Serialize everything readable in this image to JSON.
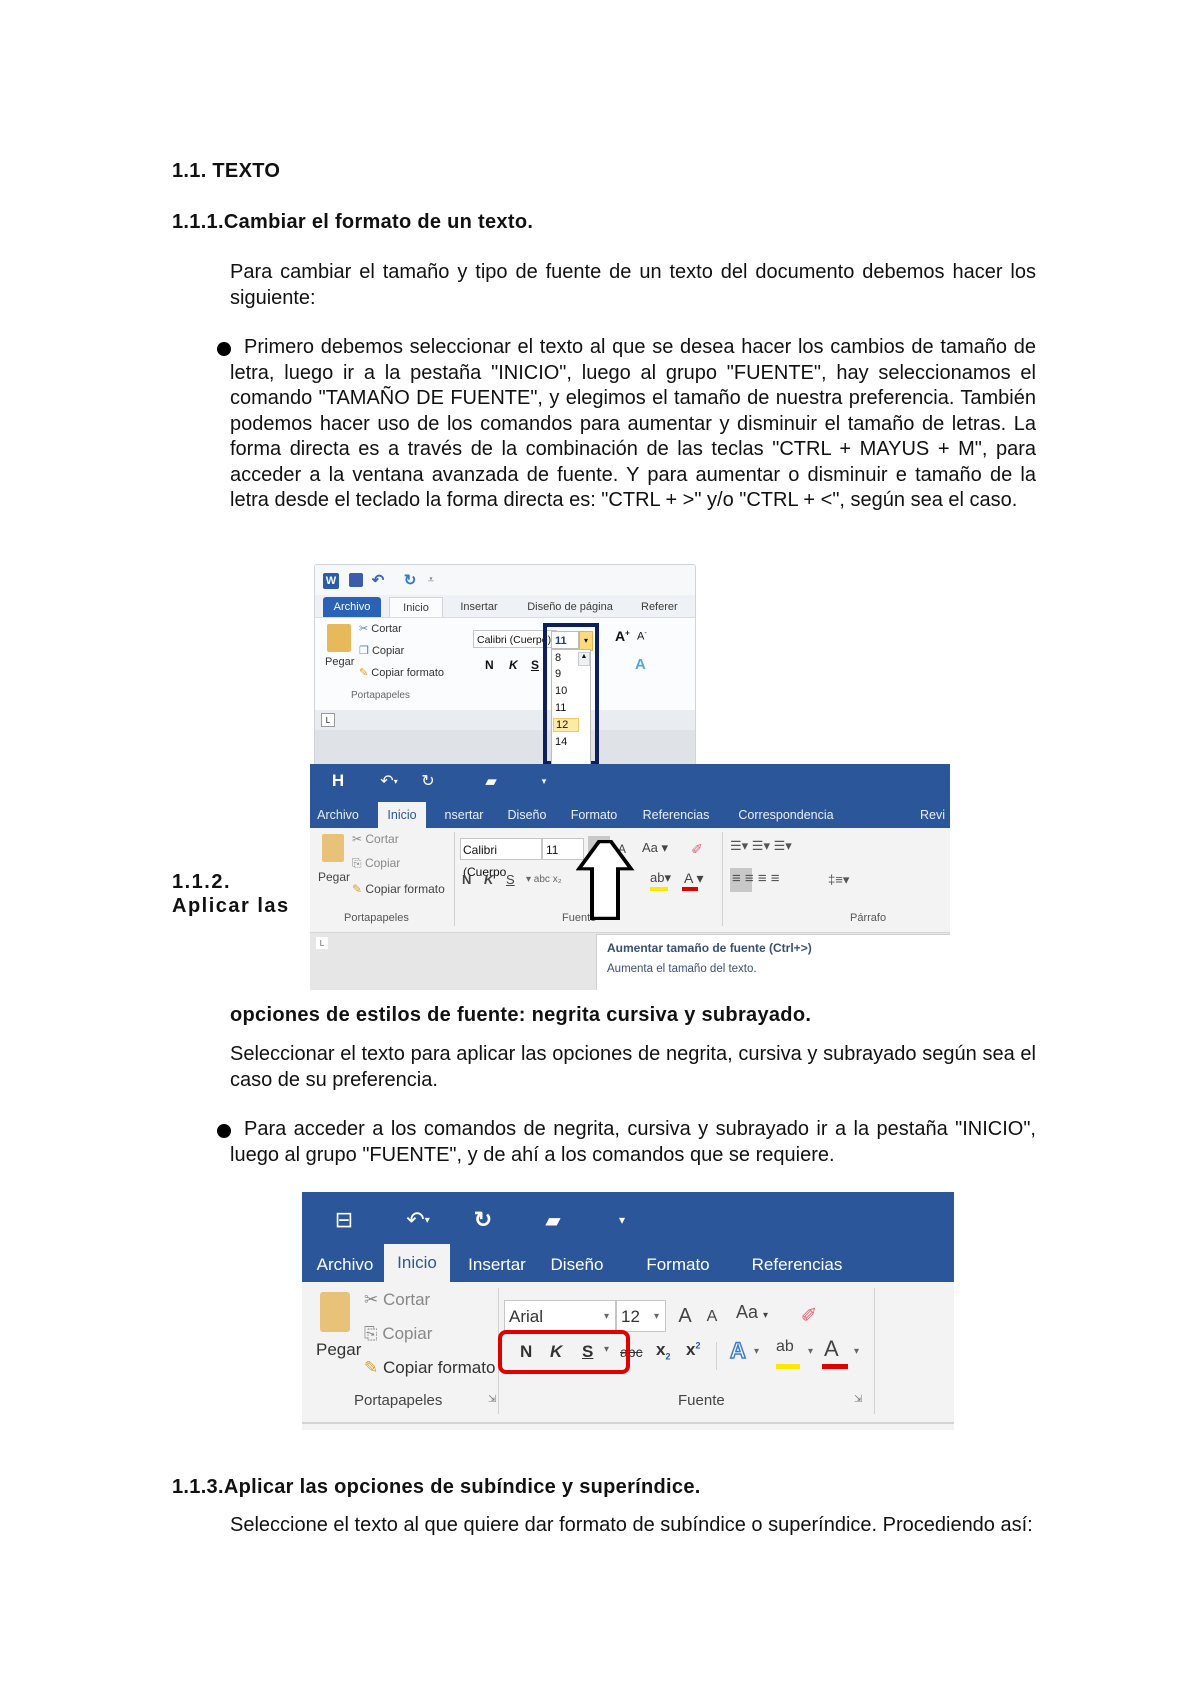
{
  "document": {
    "heading_1": "1.1. TEXTO",
    "section_1": {
      "number": "1.1.1.",
      "title": "Cambiar el formato de un texto.",
      "intro": "Para cambiar el tamaño y tipo de fuente de un texto del documento debemos hacer los siguiente:",
      "bullet": "Primero debemos seleccionar el texto al que se desea hacer los cambios de tamaño de letra, luego ir a la pestaña \"INICIO\", luego al grupo \"FUENTE\", hay seleccionamos el comando \"TAMAÑO DE FUENTE\", y elegimos el tamaño de nuestra preferencia. También podemos hacer uso de los comandos para aumentar y disminuir el tamaño de letras. La forma directa es a través de la combinación de las teclas \"CTRL + MAYUS + M\", para acceder a la ventana avanzada de fuente. Y para aumentar o disminuir e tamaño de la letra desde el teclado la forma directa es: \"CTRL + >\" y/o \"CTRL + <\", según sea el caso."
    },
    "section_2": {
      "number": "1.1.2.",
      "title_part1": "Aplicar las",
      "title_part2": "opciones de estilos de fuente: negrita cursiva y subrayado.",
      "intro": "Seleccionar el texto para aplicar las opciones de negrita, cursiva y subrayado según sea el caso de su preferencia.",
      "bullet": "Para acceder a los comandos de negrita, cursiva y subrayado ir a la pestaña \"INICIO\", luego al grupo \"FUENTE\", y de ahí a los comandos que se requiere."
    },
    "section_3": {
      "number": "1.1.3.",
      "title": "Aplicar las opciones de subíndice y superíndice.",
      "intro": "Seleccione el texto al que quiere dar formato de subíndice o superíndice. Procediendo así:"
    }
  },
  "screenshot_word2010": {
    "tabs": [
      "Archivo",
      "Inicio",
      "Insertar",
      "Diseño de página",
      "Referer"
    ],
    "clipboard": {
      "paste": "Pegar",
      "cut": "Cortar",
      "copy": "Copiar",
      "format_painter": "Copiar formato",
      "group": "Portapapeles"
    },
    "font": {
      "name": "Calibri (Cuerpo)",
      "size": "11",
      "bold": "N",
      "italic": "K",
      "underline": "S"
    },
    "size_options": [
      "8",
      "9",
      "10",
      "11",
      "12",
      "14"
    ],
    "size_highlighted": "12",
    "highlight_color": "#0d1f5c"
  },
  "screenshot_word2016_a": {
    "tabs": [
      "Archivo",
      "Inicio",
      "nsertar",
      "Diseño",
      "Formato",
      "Referencias",
      "Correspondencia",
      "Revi"
    ],
    "clipboard": {
      "paste": "Pegar",
      "cut": "Cortar",
      "copy": "Copiar",
      "format_painter": "Copiar formato",
      "group": "Portapapeles"
    },
    "font": {
      "name": "Calibri (Cuerpo",
      "size": "11",
      "bold": "N",
      "italic": "K",
      "underline": "S",
      "group": "Fuente",
      "case": "Aa"
    },
    "paragraph_group": "Párrafo",
    "tooltip": {
      "title": "Aumentar tamaño de fuente (Ctrl+>)",
      "description": "Aumenta el tamaño del texto."
    },
    "title_bar_color": "#2b579a"
  },
  "screenshot_word2016_b": {
    "tabs": [
      "Archivo",
      "Inicio",
      "Insertar",
      "Diseño",
      "Formato",
      "Referencias"
    ],
    "clipboard": {
      "paste": "Pegar",
      "cut": "Cortar",
      "copy": "Copiar",
      "format_painter": "Copiar formato",
      "group": "Portapapeles"
    },
    "font": {
      "name": "Arial",
      "size": "12",
      "bold": "N",
      "italic": "K",
      "underline": "S",
      "strike": "abc",
      "group": "Fuente",
      "case": "Aa"
    },
    "highlight_box_color": "#e00000"
  }
}
